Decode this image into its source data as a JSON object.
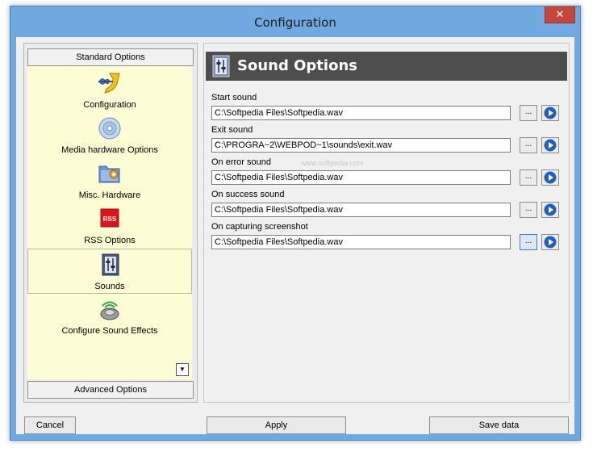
{
  "window": {
    "title": "Configuration",
    "close_glyph": "✕"
  },
  "left_panel": {
    "standard_header": "Standard Options",
    "advanced_header": "Advanced Options",
    "items": [
      {
        "label": "Configuration",
        "icon": "configuration-icon"
      },
      {
        "label": "Media hardware Options",
        "icon": "media-hardware-icon"
      },
      {
        "label": "Misc. Hardware",
        "icon": "misc-hardware-icon"
      },
      {
        "label": "RSS Options",
        "icon": "rss-icon",
        "icon_text": "RSS"
      },
      {
        "label": "Sounds",
        "icon": "sounds-icon",
        "selected": true
      },
      {
        "label": "Configure Sound Effects",
        "icon": "sound-effects-icon"
      }
    ],
    "scroll_glyph": "▼"
  },
  "right_panel": {
    "title": "Sound Options",
    "browse_label": "...",
    "fields": [
      {
        "label": "Start sound",
        "value": "C:\\Softpedia Files\\Softpedia.wav"
      },
      {
        "label": "Exit sound",
        "value": "C:\\PROGRA~2\\WEBPOD~1\\sounds\\exit.wav"
      },
      {
        "label": "On error sound",
        "value": "C:\\Softpedia Files\\Softpedia.wav"
      },
      {
        "label": "On success sound",
        "value": "C:\\Softpedia Files\\Softpedia.wav"
      },
      {
        "label": "On capturing screenshot",
        "value": "C:\\Softpedia Files\\Softpedia.wav"
      }
    ]
  },
  "buttons": {
    "cancel": "Cancel",
    "apply": "Apply",
    "save": "Save data"
  },
  "watermark": "www.softpedia.com",
  "colors": {
    "title_bar": "#6fa9e0",
    "close": "#c7463a",
    "nav_bg": "#fcfcd5",
    "header_bg": "#4d4d4d",
    "play": "#1f5fc4"
  }
}
